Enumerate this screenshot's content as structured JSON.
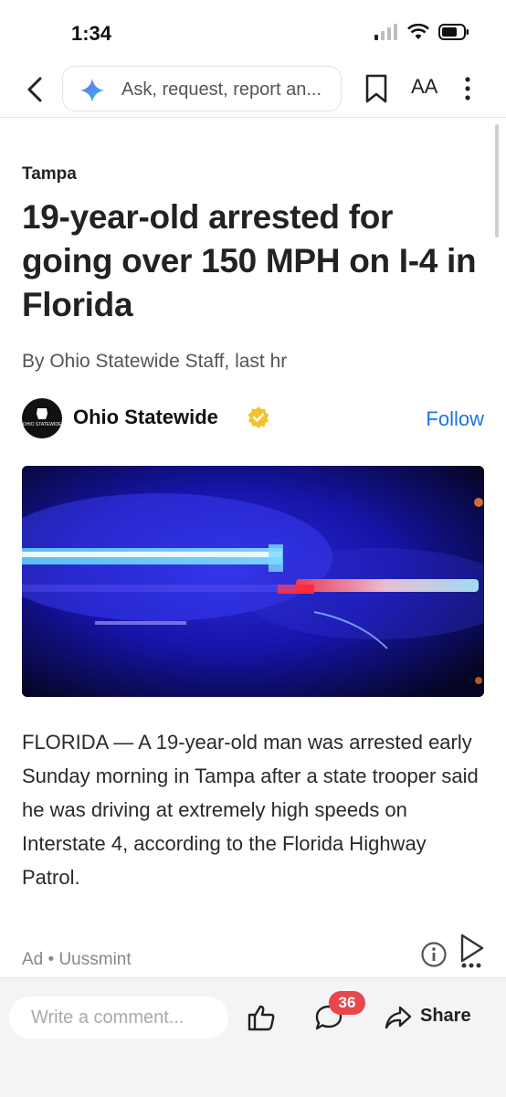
{
  "status": {
    "time": "1:34"
  },
  "toolbar": {
    "search_placeholder": "Ask, request, report an...",
    "text_size_label": "AA"
  },
  "article": {
    "section": "Tampa",
    "headline": "19-year-old arrested for going over 150 MPH on I-4 in Florida",
    "byline": "By Ohio Statewide Staff,  last hr",
    "publisher": {
      "name": "Ohio Statewide",
      "logo_text": "OHIO STATEWIDE",
      "follow_label": "Follow"
    },
    "body": "FLORIDA — A 19-year-old man was arrested early Sunday morning in Tampa after a state trooper said he was driving at extremely high speeds on Interstate 4, according to the Florida Highway Patrol."
  },
  "ad": {
    "label": "Ad • Uussmint"
  },
  "bottom_bar": {
    "comment_placeholder": "Write a comment...",
    "comment_count": "36",
    "share_label": "Share"
  },
  "colors": {
    "accent": "#1a73e8",
    "badge": "#e8474b",
    "verified": "#f2c230"
  }
}
